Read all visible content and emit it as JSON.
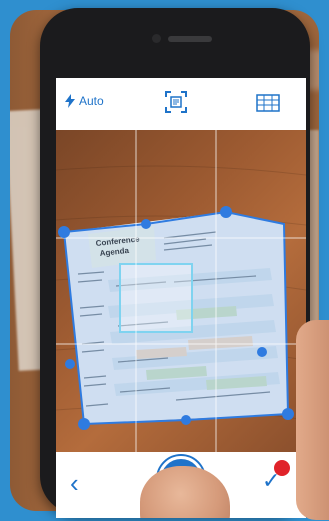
{
  "toolbar": {
    "flash_label": "Auto",
    "flash_icon": "lightning-bolt-icon",
    "scan_icon": "document-scan-icon",
    "grid_icon": "table-grid-icon"
  },
  "document": {
    "title_line1": "Conference",
    "title_line2": "Agenda"
  },
  "bottombar": {
    "back_glyph": "‹",
    "done_glyph": "✓"
  },
  "colors": {
    "accent": "#1f73c9",
    "badge": "#e0232a",
    "frame": "#2f8fcf"
  }
}
